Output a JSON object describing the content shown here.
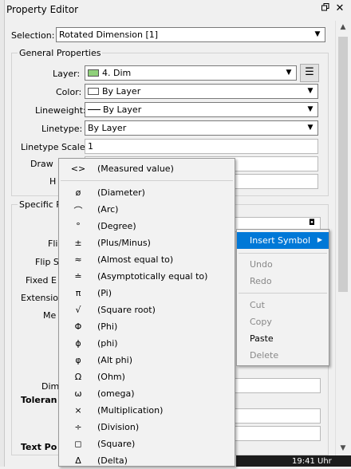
{
  "window": {
    "title": "Property Editor",
    "float_icon": "restore-icon",
    "close_icon": "close-icon"
  },
  "selection": {
    "label": "Selection:",
    "value": "Rotated Dimension [1]"
  },
  "general": {
    "title": "General Properties",
    "layer": {
      "label": "Layer:",
      "value": "4. Dim",
      "swatch_color": "#8fd07a"
    },
    "color": {
      "label": "Color:",
      "value": "By Layer",
      "swatch_color": "#ffffff"
    },
    "lineweight": {
      "label": "Lineweight:",
      "value": "By Layer"
    },
    "linetype": {
      "label": "Linetype:",
      "value": "By Layer"
    },
    "linetype_scale": {
      "label": "Linetype Scale:",
      "value": "1"
    },
    "draw_order_label": "Draw",
    "h_label": "H"
  },
  "specific": {
    "title": "Specific P",
    "labels": {
      "fli": "Fli",
      "flip_s": "Flip S",
      "fixed_e": "Fixed E",
      "extension": "Extension",
      "me": "Me",
      "dim": "Dim",
      "toleran": "Toleran",
      "text_po": "Text Po"
    }
  },
  "symbol_menu": {
    "items": [
      {
        "sym": "<>",
        "label": "(Measured value)"
      },
      {
        "sym": "ø",
        "label": "(Diameter)"
      },
      {
        "sym": "⌒",
        "label": "(Arc)"
      },
      {
        "sym": "°",
        "label": "(Degree)"
      },
      {
        "sym": "±",
        "label": "(Plus/Minus)"
      },
      {
        "sym": "≈",
        "label": "(Almost equal to)"
      },
      {
        "sym": "≐",
        "label": "(Asymptotically equal to)"
      },
      {
        "sym": "π",
        "label": "(Pi)"
      },
      {
        "sym": "√",
        "label": "(Square root)"
      },
      {
        "sym": "Φ",
        "label": "(Phi)"
      },
      {
        "sym": "ϕ",
        "label": "(phi)"
      },
      {
        "sym": "φ",
        "label": "(Alt phi)"
      },
      {
        "sym": "Ω",
        "label": "(Ohm)"
      },
      {
        "sym": "ω",
        "label": "(omega)"
      },
      {
        "sym": "×",
        "label": "(Multiplication)"
      },
      {
        "sym": "÷",
        "label": "(Division)"
      },
      {
        "sym": "◻",
        "label": "(Square)"
      },
      {
        "sym": "Δ",
        "label": "(Delta)"
      }
    ]
  },
  "context_menu": {
    "insert_symbol": "Insert Symbol",
    "undo": "Undo",
    "redo": "Redo",
    "cut": "Cut",
    "copy": "Copy",
    "paste": "Paste",
    "delete": "Delete"
  },
  "taskbar": {
    "time": "19:41 Uhr"
  }
}
